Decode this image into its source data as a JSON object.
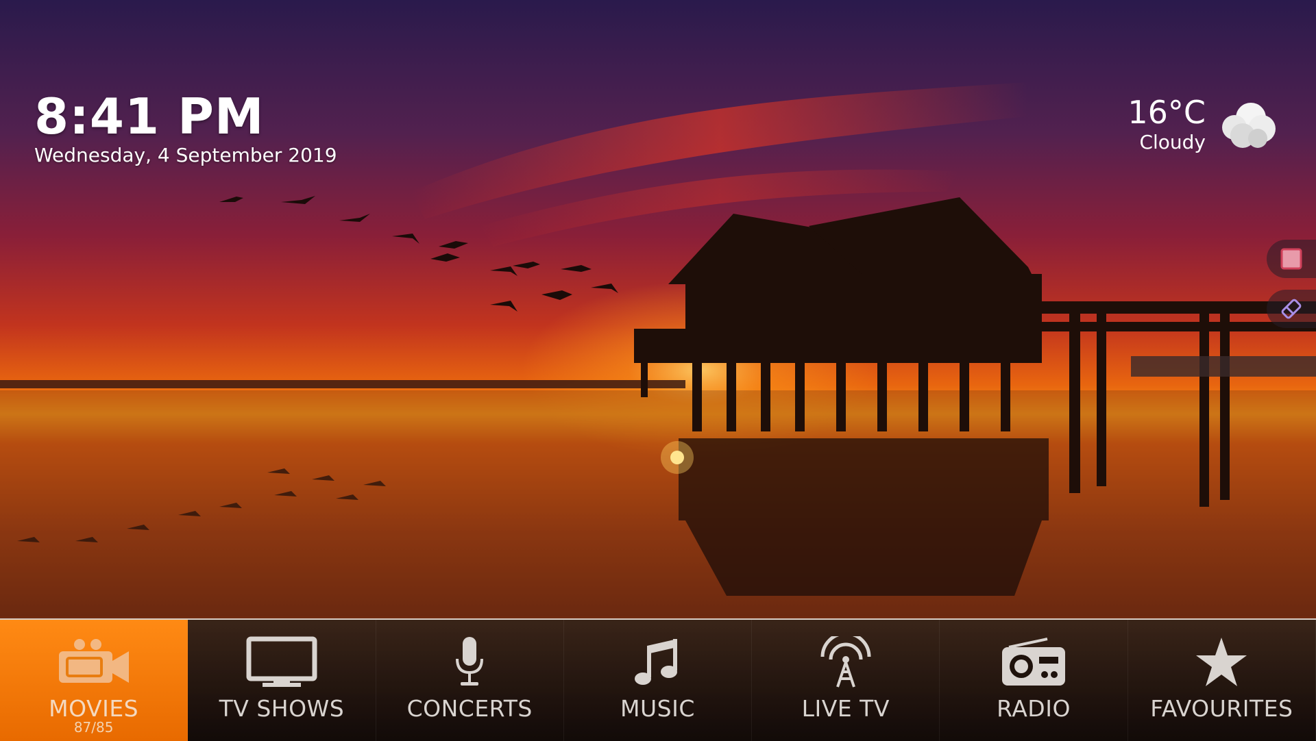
{
  "clock": {
    "time": "8:41 PM",
    "date": "Wednesday, 4 September 2019"
  },
  "weather": {
    "temperature": "16°C",
    "condition": "Cloudy",
    "icon": "cloud-icon"
  },
  "side_buttons": [
    {
      "icon": "stop-square-icon"
    },
    {
      "icon": "eraser-icon"
    }
  ],
  "menu": {
    "items": [
      {
        "label": "MOVIES",
        "count": "87/85",
        "icon": "movie-camera-icon",
        "active": true
      },
      {
        "label": "TV SHOWS",
        "icon": "tv-icon"
      },
      {
        "label": "CONCERTS",
        "icon": "microphone-icon"
      },
      {
        "label": "MUSIC",
        "icon": "music-note-icon"
      },
      {
        "label": "LIVE TV",
        "icon": "antenna-icon"
      },
      {
        "label": "RADIO",
        "icon": "radio-icon"
      },
      {
        "label": "FAVOURITES",
        "icon": "star-icon"
      }
    ]
  },
  "colors": {
    "accent": "#f57c00",
    "menu_bg": "#1e120c",
    "sky_top": "#2c1a4f",
    "sky_mid": "#c9281c",
    "sun": "#ff9a1a"
  }
}
